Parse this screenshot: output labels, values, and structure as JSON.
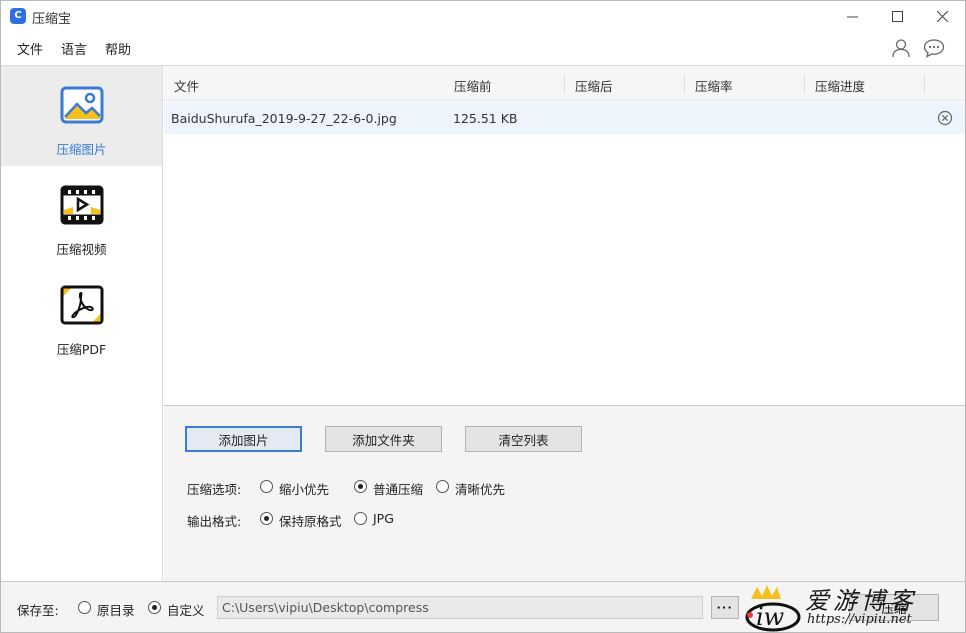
{
  "app": {
    "title": "压缩宝",
    "icon_letter": "C"
  },
  "menu": {
    "file": "文件",
    "language": "语言",
    "help": "帮助"
  },
  "sidebar": {
    "items": [
      {
        "label": "压缩图片",
        "active": true
      },
      {
        "label": "压缩视频",
        "active": false
      },
      {
        "label": "压缩PDF",
        "active": false
      }
    ]
  },
  "table": {
    "columns": [
      "文件",
      "压缩前",
      "压缩后",
      "压缩率",
      "压缩进度"
    ],
    "rows": [
      {
        "file": "BaiduShurufa_2019-9-27_22-6-0.jpg",
        "before": "125.51 KB",
        "after": "",
        "ratio": "",
        "progress": ""
      }
    ]
  },
  "actions": {
    "add_image": "添加图片",
    "add_folder": "添加文件夹",
    "clear_list": "清空列表"
  },
  "compress_options": {
    "label": "压缩选项:",
    "options": [
      "缩小优先",
      "普通压缩",
      "清晰优先"
    ],
    "selected": "普通压缩"
  },
  "output_format": {
    "label": "输出格式:",
    "options": [
      "保持原格式",
      "JPG"
    ],
    "selected": "保持原格式"
  },
  "save_to": {
    "label": "保存至:",
    "options": [
      "原目录",
      "自定义"
    ],
    "selected": "自定义",
    "path": "C:\\Users\\vipiu\\Desktop\\compress",
    "browse": "···"
  },
  "start_button": "压缩",
  "watermark": {
    "text": "爱游博客",
    "url": "https://vipiu.net"
  },
  "colors": {
    "accent": "#3a7bd5",
    "active_sidebar_bg": "#ececec",
    "selected_row_bg": "#eef4fb",
    "icon_yellow": "#f5c01c"
  }
}
